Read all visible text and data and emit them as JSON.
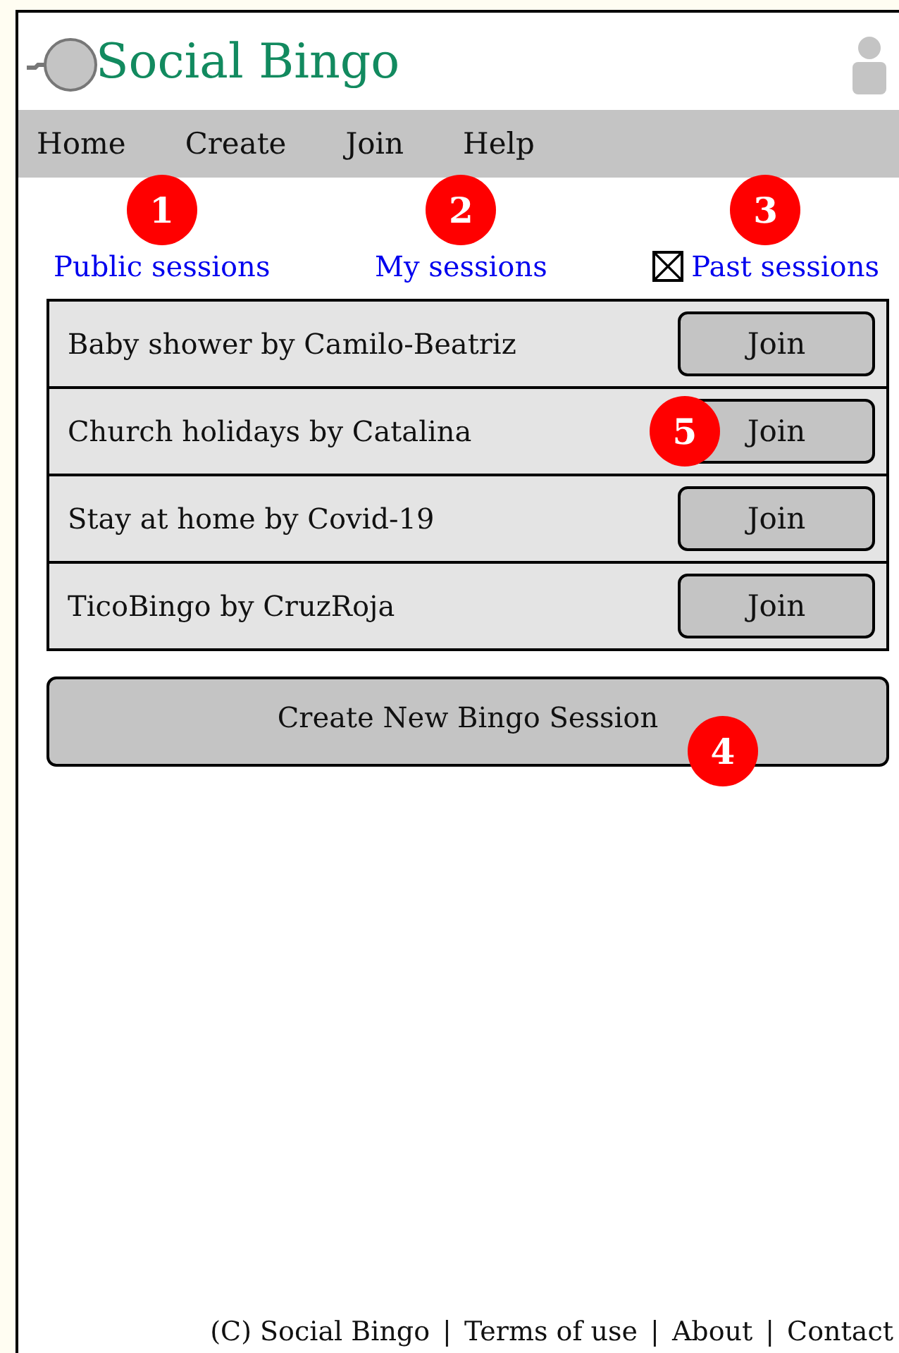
{
  "header": {
    "title": "Social Bingo"
  },
  "nav": [
    "Home",
    "Create",
    "Join",
    "Help"
  ],
  "tabs": [
    {
      "label": "Public sessions",
      "kind": "link",
      "badge": "1"
    },
    {
      "label": "My sessions",
      "kind": "link",
      "badge": "2"
    },
    {
      "label": "Past sessions",
      "kind": "checkbox",
      "checked": true,
      "badge": "3"
    }
  ],
  "sessions": [
    {
      "name": "Baby shower by Camilo-Beatriz",
      "button": "Join"
    },
    {
      "name": "Church holidays by Catalina",
      "button": "Join",
      "badge": "5"
    },
    {
      "name": "Stay at home by Covid-19",
      "button": "Join"
    },
    {
      "name": "TicoBingo by CruzRoja",
      "button": "Join"
    }
  ],
  "create_button": {
    "label": "Create New Bingo Session",
    "badge": "4"
  },
  "footer": [
    "(C) Social Bingo",
    "|",
    "Terms of use",
    "|",
    "About",
    "|",
    "Contact"
  ]
}
